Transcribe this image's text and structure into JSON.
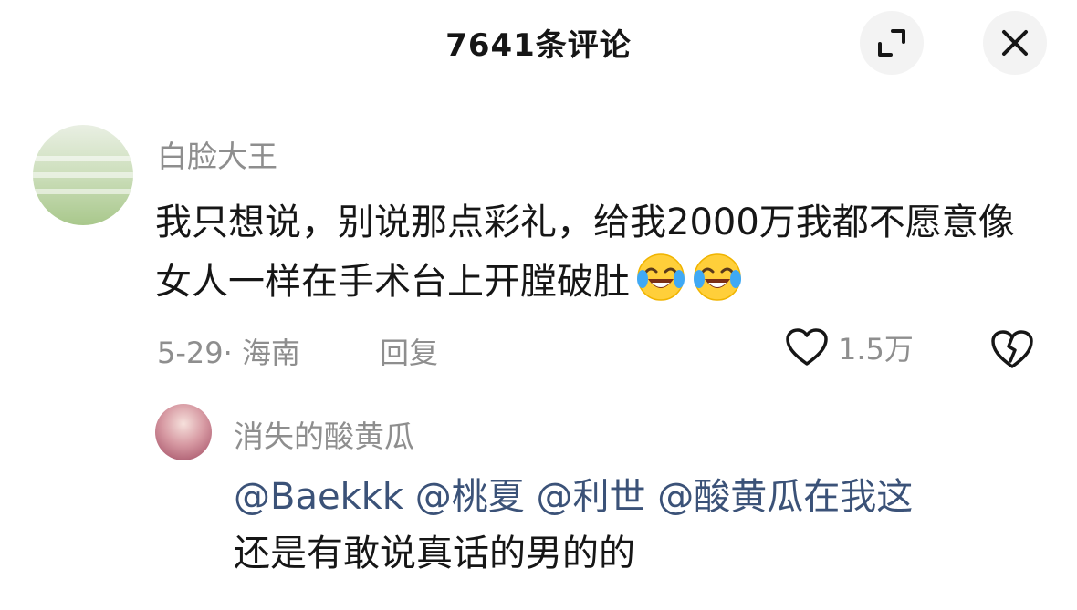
{
  "header": {
    "title": "7641条评论"
  },
  "comment": {
    "username": "白脸大王",
    "text": "我只想说，别说那点彩礼，给我2000万我都不愿意像女人一样在手术台上开膛破肚",
    "emojis": [
      "laughing-crying-emoji",
      "laughing-crying-emoji"
    ],
    "date_location": "5-29· 海南",
    "reply_label": "回复",
    "like_count": "1.5万"
  },
  "reply": {
    "username": "消失的酸黄瓜",
    "mentions": [
      "@Baekkk",
      "@桃夏",
      "@利世",
      "@酸黄瓜在我这"
    ],
    "text": "还是有敢说真话的男的的"
  },
  "icons": {
    "expand": "expand-icon",
    "close": "close-icon",
    "like": "heart-icon",
    "dislike": "broken-heart-icon"
  },
  "colors": {
    "text_primary": "#161616",
    "text_secondary": "#8e8e8e",
    "mention": "#3b5278",
    "button_bg": "#f3f3f3"
  }
}
